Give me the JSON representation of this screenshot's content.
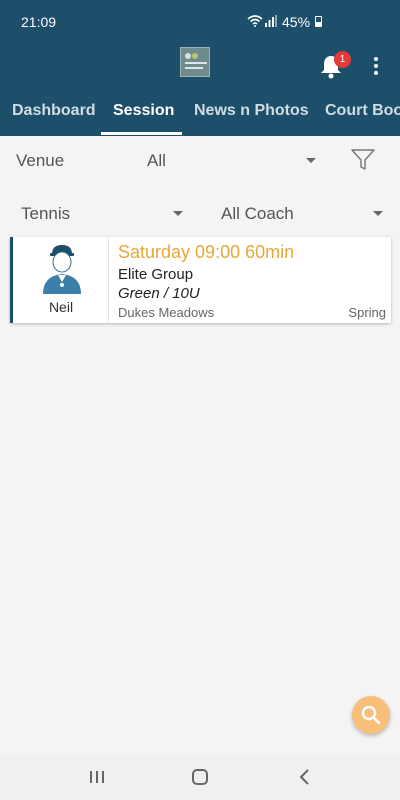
{
  "status": {
    "time": "21:09",
    "battery": "45%"
  },
  "notifications": {
    "count": "1"
  },
  "tabs": [
    "Dashboard",
    "Session",
    "News n Photos",
    "Court Book"
  ],
  "filters": {
    "venue_label": "Venue",
    "venue_value": "All",
    "sport_value": "Tennis",
    "coach_value": "All Coach"
  },
  "session_card": {
    "coach_name": "Neil",
    "title": "Saturday 09:00 60min",
    "group": "Elite Group",
    "level": "Green / 10U",
    "venue": "Dukes Meadows",
    "term": "Spring"
  },
  "colors": {
    "brand": "#1d4e6a",
    "accent": "#e8a838",
    "fab": "#f7bf7a",
    "badge": "#e53935"
  },
  "icons": [
    "wifi-icon",
    "signal-icon",
    "battery-icon",
    "bell-icon",
    "more-vert-icon",
    "filter-icon",
    "search-icon",
    "recents-icon",
    "home-icon",
    "back-icon"
  ]
}
